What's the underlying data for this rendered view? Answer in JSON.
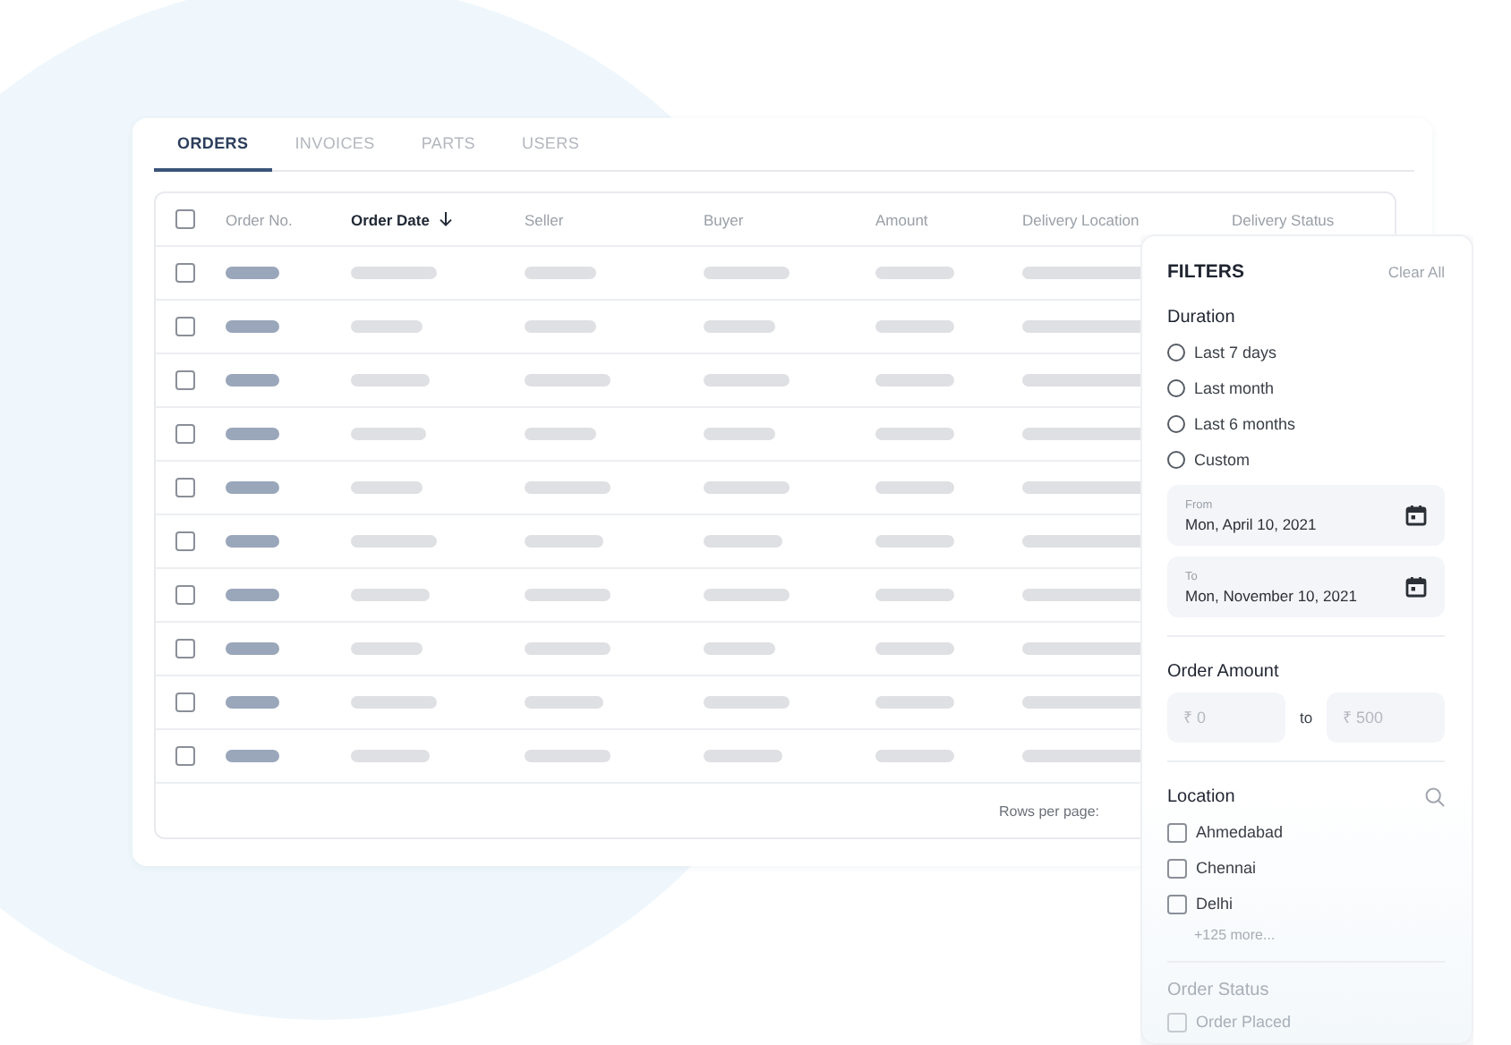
{
  "tabs": [
    {
      "label": "ORDERS",
      "selected": true
    },
    {
      "label": "INVOICES",
      "selected": false
    },
    {
      "label": "PARTS",
      "selected": false
    },
    {
      "label": "USERS",
      "selected": false
    }
  ],
  "table": {
    "select_all": {
      "checked": false
    },
    "columns": [
      {
        "label": "Order No.",
        "sorted": false
      },
      {
        "label": "Order Date",
        "sorted": true
      },
      {
        "label": "Seller",
        "sorted": false
      },
      {
        "label": "Buyer",
        "sorted": false
      },
      {
        "label": "Amount",
        "sorted": false
      },
      {
        "label": "Delivery Location",
        "sorted": false
      },
      {
        "label": "Delivery Status",
        "sorted": false
      }
    ],
    "rows": [
      {
        "checked": false
      },
      {
        "checked": false
      },
      {
        "checked": false
      },
      {
        "checked": false
      },
      {
        "checked": false
      },
      {
        "checked": false
      },
      {
        "checked": false
      },
      {
        "checked": false
      },
      {
        "checked": false
      },
      {
        "checked": false
      }
    ],
    "footer": {
      "rows_per_page_label": "Rows per page:"
    }
  },
  "filters": {
    "title": "FILTERS",
    "clear_all": "Clear All",
    "duration": {
      "title": "Duration",
      "options": [
        {
          "label": "Last 7 days",
          "selected": false
        },
        {
          "label": "Last month",
          "selected": false
        },
        {
          "label": "Last 6 months",
          "selected": false
        },
        {
          "label": "Custom",
          "selected": false
        }
      ],
      "dates": [
        {
          "label": "From",
          "value": "Mon, April 10, 2021"
        },
        {
          "label": "To",
          "value": "Mon, November 10, 2021"
        }
      ]
    },
    "order_amount": {
      "title": "Order Amount",
      "min": {
        "placeholder": "₹ 0"
      },
      "separator": "to",
      "max": {
        "placeholder": "₹ 500"
      }
    },
    "location": {
      "title": "Location",
      "options": [
        {
          "label": "Ahmedabad",
          "checked": false
        },
        {
          "label": "Chennai",
          "checked": false
        },
        {
          "label": "Delhi",
          "checked": false
        }
      ],
      "more": "+125 more..."
    },
    "order_status": {
      "title": "Order Status",
      "options": [
        {
          "label": "Order Placed",
          "checked": false
        }
      ]
    }
  }
}
